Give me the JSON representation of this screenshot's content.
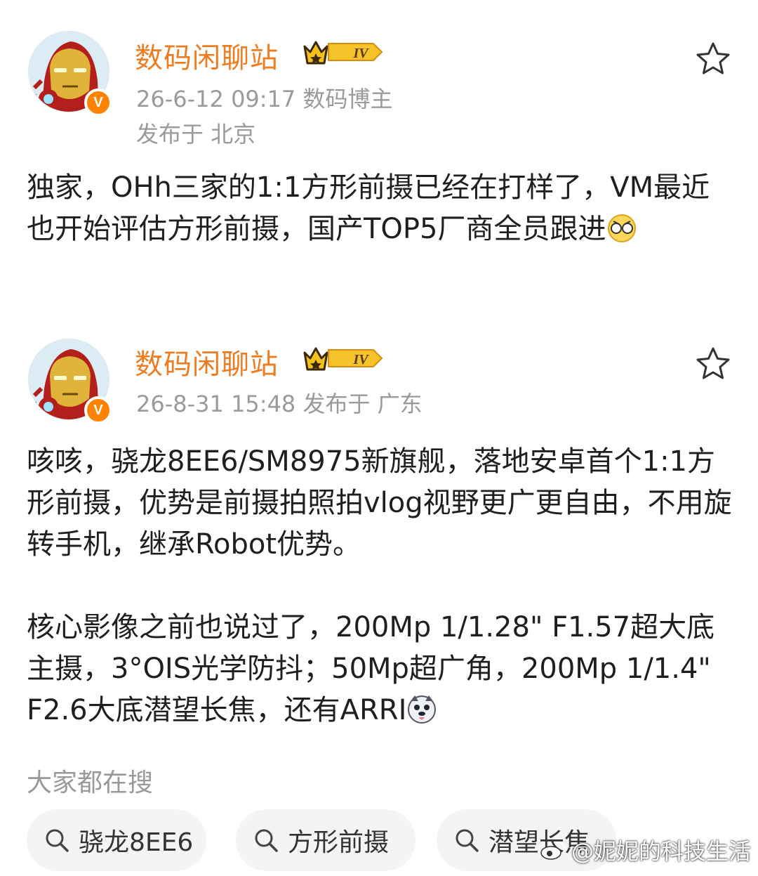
{
  "posts": [
    {
      "author": "数码闲聊站",
      "level": "IV",
      "meta_line1": "26-6-12 09:17  数码博主",
      "meta_line2": "发布于 北京",
      "text": "独家，OHh三家的1:1方形前摄已经在打样了，VM最近也开始评估方形前摄，国产TOP5厂商全员跟进"
    },
    {
      "author": "数码闲聊站",
      "level": "IV",
      "meta_line1": "26-8-31 15:48  发布于 广东",
      "text": "咳咳，骁龙8EE6/SM8975新旗舰，落地安卓首个1:1方形前摄，优势是前摄拍照拍vlog视野更广更自由，不用旋转手机，继承Robot优势。\n\n核心影像之前也说过了，200Mp 1/1.28\" F1.57超大底主摄，3°OIS光学防抖；50Mp超广角，200Mp 1/1.4\" F2.6大底潜望长焦，还有ARRI"
    }
  ],
  "search_section": {
    "title": "大家都在搜",
    "chips": [
      "骁龙8EE6",
      "方形前摄",
      "潜望长焦"
    ]
  },
  "verified_badge": "V",
  "watermark": "@妮妮的科技生活",
  "colors": {
    "author_name": "#f07c22",
    "meta": "#9a9a9a",
    "verified": "#ff8200",
    "chip_bg": "#f4f4f4"
  },
  "icons": [
    "avatar-ironman",
    "crown-level-badge",
    "verified-badge",
    "star-icon",
    "emoji-grimace",
    "emoji-husky",
    "search-icon",
    "weibo-logo-icon"
  ]
}
